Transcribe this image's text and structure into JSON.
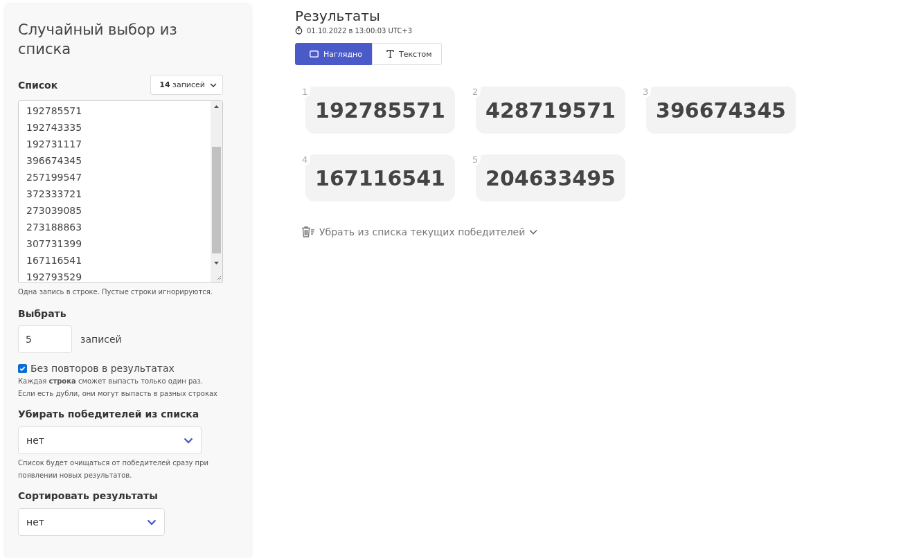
{
  "sidebar": {
    "title": "Случайный выбор из списка",
    "list": {
      "label": "Список",
      "count_button": "**14** записей",
      "lines": [
        "192785571",
        "192743335",
        "192731117",
        "396674345",
        "257199547",
        "372333721",
        "273039085",
        "273188863",
        "307731399",
        "167116541",
        "192793529"
      ],
      "hint": "Одна запись в строке. Пустые строки игнорируются."
    },
    "pick": {
      "label": "Выбрать",
      "value": "5",
      "unit": "записей"
    },
    "no_repeat": {
      "label": "Без повторов в результатах",
      "checked": true,
      "hint": "Каждая **строка** сможет выпасть только один раз.\nЕсли есть дубли, они могут выпасть в разных строках"
    },
    "remove_winners": {
      "label": "Убирать победителей из списка",
      "value": "нет",
      "hint": "Список будет очищаться от победителей сразу при появлении новых результатов."
    },
    "sort": {
      "label": "Сортировать результаты",
      "value": "нет"
    }
  },
  "results": {
    "title": "Результаты",
    "timestamp": "01.10.2022 в 13:00:03 UTC+3",
    "tabs": [
      {
        "label": "Наглядно",
        "kind": "visual",
        "selected": true
      },
      {
        "label": "Текстом",
        "kind": "text",
        "selected": false
      }
    ],
    "items": [
      {
        "index": "1",
        "value": "192785571"
      },
      {
        "index": "2",
        "value": "428719571"
      },
      {
        "index": "3",
        "value": "396674345"
      },
      {
        "index": "4",
        "value": "167116541"
      },
      {
        "index": "5",
        "value": "204633495"
      }
    ],
    "remove_link": "Убрать из списка текущих победителей"
  }
}
